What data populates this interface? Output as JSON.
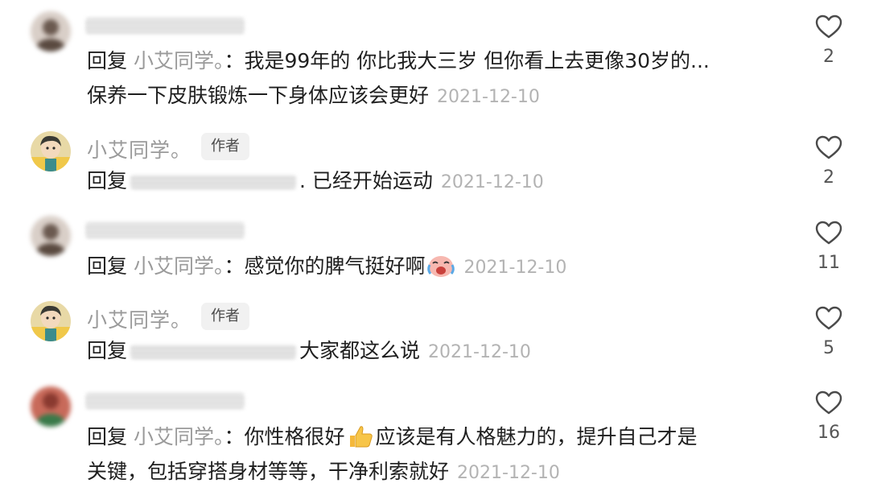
{
  "reply_word": "回复",
  "author_badge": "作者",
  "comments": [
    {
      "reply_to": "小艾同学。",
      "separator": "：",
      "line1": "我是99年的 你比我大三岁 但你看上去更像30岁的...",
      "line2": "保养一下皮肤锻炼一下身体应该会更好",
      "timestamp": "2021-12-10",
      "likes": "2"
    },
    {
      "author_name": "小艾同学。",
      "text": ". 已经开始运动",
      "timestamp": "2021-12-10",
      "likes": "2"
    },
    {
      "reply_to": "小艾同学。",
      "separator": "：",
      "line1": "感觉你的脾气挺好啊",
      "emoji": "crying-laughing-emoji",
      "timestamp": "2021-12-10",
      "likes": "11"
    },
    {
      "author_name": "小艾同学。",
      "text": "大家都这么说",
      "timestamp": "2021-12-10",
      "likes": "5"
    },
    {
      "reply_to": "小艾同学。",
      "separator": "：",
      "line1_a": "你性格很好",
      "emoji": "thumbs-up-emoji",
      "line1_b": "应该是有人格魅力的，提升自己才是",
      "line2": "关键，包括穿搭身材等等，干净利索就好",
      "timestamp": "2021-12-10",
      "likes": "16"
    }
  ],
  "icons": {
    "like": "heart-outline-icon"
  },
  "colors": {
    "muted": "#9a9a9a",
    "timestamp": "#b3b3b3",
    "text": "#1f1f1f"
  }
}
